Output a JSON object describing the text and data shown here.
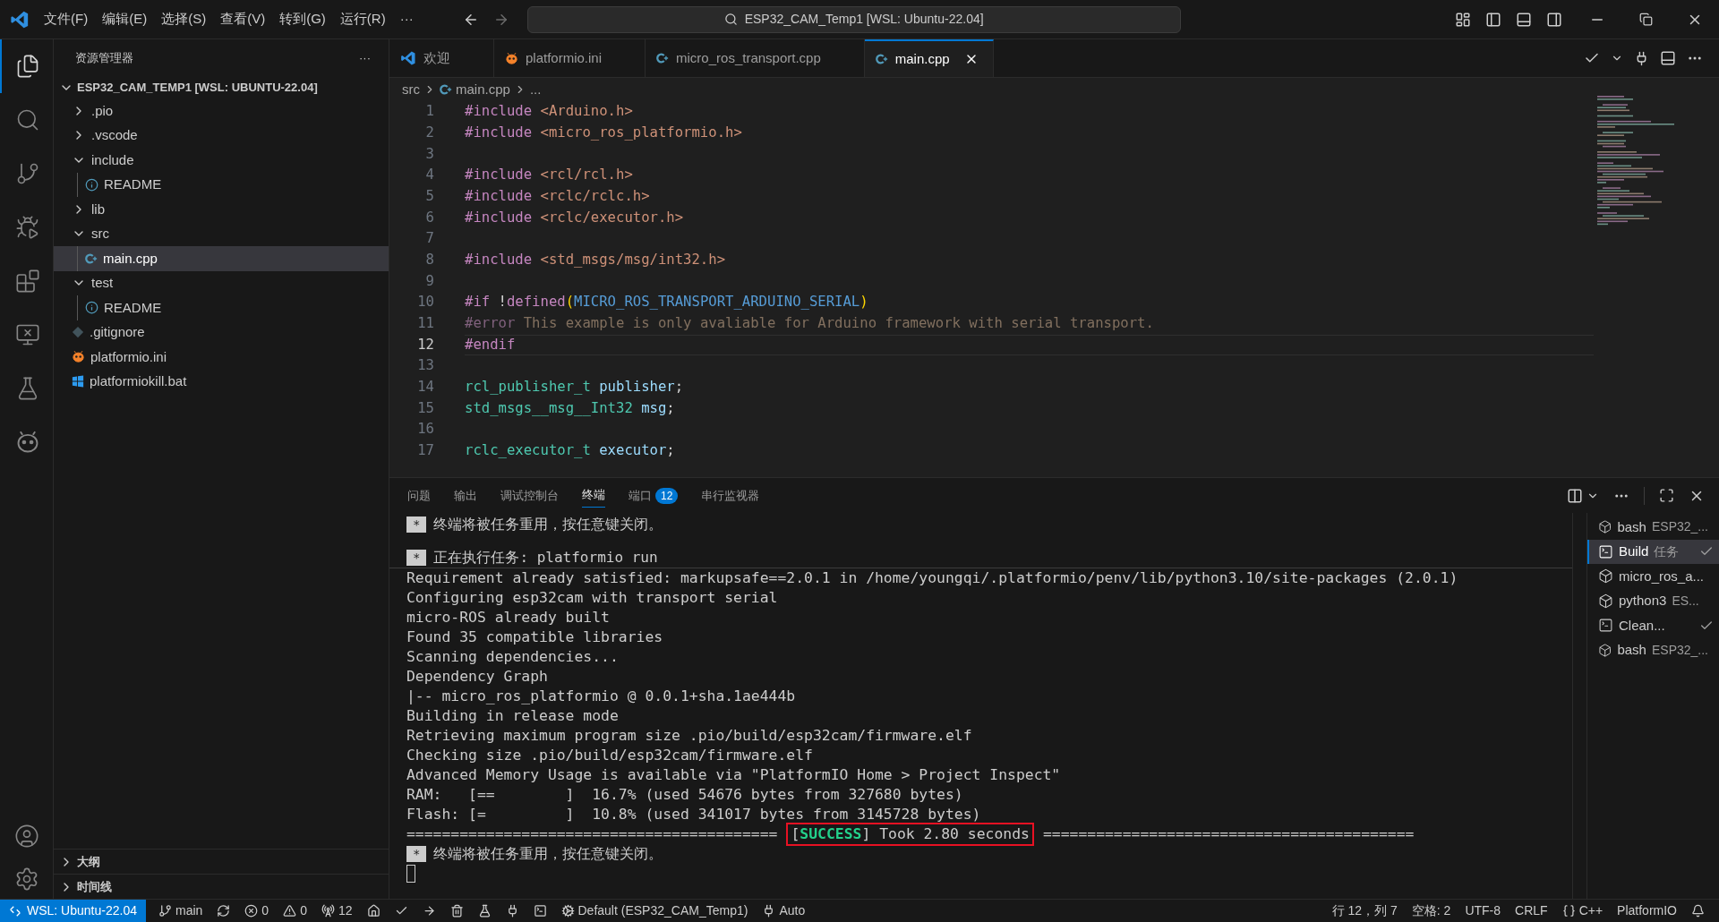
{
  "menu": [
    "文件(F)",
    "编辑(E)",
    "选择(S)",
    "查看(V)",
    "转到(G)",
    "运行(R)",
    "···"
  ],
  "command_center": {
    "text": "ESP32_CAM_Temp1 [WSL: Ubuntu-22.04]"
  },
  "activity_bar": [
    {
      "kind": "files",
      "selected": true
    },
    {
      "kind": "search",
      "selected": false
    },
    {
      "kind": "branch",
      "selected": false
    },
    {
      "kind": "debug",
      "selected": false
    },
    {
      "kind": "extensions",
      "selected": false
    },
    {
      "kind": "remote",
      "selected": false
    },
    {
      "kind": "flask",
      "selected": false
    },
    {
      "kind": "alien",
      "selected": false
    }
  ],
  "sidebar": {
    "title": "资源管理器",
    "more": "···",
    "root": "ESP32_CAM_TEMP1 [WSL: UBUNTU-22.04]",
    "items": [
      {
        "label": ".pio",
        "kind": "folder",
        "expanded": false,
        "selected": false
      },
      {
        "label": ".vscode",
        "kind": "folder",
        "expanded": false,
        "selected": false
      },
      {
        "label": "include",
        "kind": "folder",
        "expanded": true,
        "selected": false,
        "children": [
          {
            "label": "README",
            "kind": "info",
            "selected": false
          }
        ]
      },
      {
        "label": "lib",
        "kind": "folder",
        "expanded": false,
        "selected": false
      },
      {
        "label": "src",
        "kind": "folder",
        "expanded": true,
        "selected": false,
        "children": [
          {
            "label": "main.cpp",
            "kind": "cpp",
            "selected": true
          }
        ]
      },
      {
        "label": "test",
        "kind": "folder",
        "expanded": true,
        "selected": false,
        "children": [
          {
            "label": "README",
            "kind": "info",
            "selected": false
          }
        ]
      },
      {
        "label": ".gitignore",
        "kind": "git",
        "selected": false
      },
      {
        "label": "platformio.ini",
        "kind": "pio",
        "selected": false
      },
      {
        "label": "platformiokill.bat",
        "kind": "windows",
        "selected": false
      }
    ],
    "sections": [
      {
        "label": "大纲",
        "expanded": false
      },
      {
        "label": "时间线",
        "expanded": false
      }
    ]
  },
  "tabs": [
    {
      "label": "欢迎",
      "kind": "vscode",
      "selected": false
    },
    {
      "label": "platformio.ini",
      "kind": "pio",
      "selected": false
    },
    {
      "label": "micro_ros_transport.cpp",
      "kind": "cpp",
      "selected": false
    },
    {
      "label": "main.cpp",
      "kind": "cpp",
      "selected": true
    }
  ],
  "breadcrumb": [
    "src",
    "main.cpp",
    "..."
  ],
  "code": [
    {
      "n": "1",
      "current": false,
      "tokens": [
        {
          "kind": "pp",
          "text": "#include"
        },
        {
          "kind": "str",
          "text": " <Arduino.h>"
        }
      ]
    },
    {
      "n": "2",
      "current": false,
      "tokens": [
        {
          "kind": "pp",
          "text": "#include"
        },
        {
          "kind": "str",
          "text": " <micro_ros_platformio.h>"
        }
      ]
    },
    {
      "n": "3",
      "current": false
    },
    {
      "n": "4",
      "current": false,
      "tokens": [
        {
          "kind": "pp",
          "text": "#include"
        },
        {
          "kind": "str",
          "text": " <rcl/rcl.h>"
        }
      ]
    },
    {
      "n": "5",
      "current": false,
      "tokens": [
        {
          "kind": "pp",
          "text": "#include"
        },
        {
          "kind": "str",
          "text": " <rclc/rclc.h>"
        }
      ]
    },
    {
      "n": "6",
      "current": false,
      "tokens": [
        {
          "kind": "pp",
          "text": "#include"
        },
        {
          "kind": "str",
          "text": " <rclc/executor.h>"
        }
      ]
    },
    {
      "n": "7",
      "current": false
    },
    {
      "n": "8",
      "current": false,
      "tokens": [
        {
          "kind": "pp",
          "text": "#include"
        },
        {
          "kind": "str",
          "text": " <std_msgs/msg/int32.h>"
        }
      ]
    },
    {
      "n": "9",
      "current": false
    },
    {
      "n": "10",
      "current": false,
      "tokens": [
        {
          "kind": "pp",
          "text": "#if"
        },
        {
          "kind": "plain",
          "text": " !"
        },
        {
          "kind": "pp",
          "text": "defined"
        },
        {
          "kind": "paren",
          "text": "("
        },
        {
          "kind": "macro",
          "text": "MICRO_ROS_TRANSPORT_ARDUINO_SERIAL"
        },
        {
          "kind": "paren",
          "text": ")"
        }
      ]
    },
    {
      "n": "11",
      "current": false,
      "tokens": [
        {
          "kind": "pp_dim",
          "text": "#error"
        },
        {
          "kind": "dim",
          "text": " This example is only avaliable for Arduino framework with serial transport."
        }
      ]
    },
    {
      "n": "12",
      "current": true,
      "tokens": [
        {
          "kind": "pp",
          "text": "#endif"
        }
      ]
    },
    {
      "n": "13",
      "current": false
    },
    {
      "n": "14",
      "current": false,
      "tokens": [
        {
          "kind": "type",
          "text": "rcl_publisher_t"
        },
        {
          "kind": "var",
          "text": " publisher"
        },
        {
          "kind": "plain",
          "text": ";"
        }
      ]
    },
    {
      "n": "15",
      "current": false,
      "tokens": [
        {
          "kind": "type",
          "text": "std_msgs__msg__Int32"
        },
        {
          "kind": "var",
          "text": " msg"
        },
        {
          "kind": "plain",
          "text": ";"
        }
      ]
    },
    {
      "n": "16",
      "current": false
    },
    {
      "n": "17",
      "current": false,
      "tokens": [
        {
          "kind": "type",
          "text": "rclc_executor_t"
        },
        {
          "kind": "var",
          "text": " executor"
        },
        {
          "kind": "plain",
          "text": ";"
        }
      ]
    }
  ],
  "panel": {
    "tabs": [
      {
        "label": "问题",
        "selected": false
      },
      {
        "label": "输出",
        "selected": false
      },
      {
        "label": "调试控制台",
        "selected": false
      },
      {
        "label": "终端",
        "selected": true
      },
      {
        "label": "端口",
        "badge": "12",
        "selected": false
      },
      {
        "label": "串行监视器",
        "selected": false
      }
    ],
    "terminal": [
      {
        "kind": "task",
        "badge": "*",
        "text": "终端将被任务重用，按任意键关闭。"
      },
      {
        "kind": "task",
        "badge": "*",
        "text": "正在执行任务: platformio run"
      },
      {
        "kind": "text",
        "text": "Requirement already satisfied: markupsafe==2.0.1 in /home/youngqi/.platformio/penv/lib/python3.10/site-packages (2.0.1)"
      },
      {
        "kind": "text",
        "text": "Configuring esp32cam with transport serial"
      },
      {
        "kind": "text",
        "text": "micro-ROS already built"
      },
      {
        "kind": "text",
        "text": "Found 35 compatible libraries"
      },
      {
        "kind": "text",
        "text": "Scanning dependencies..."
      },
      {
        "kind": "text",
        "text": "Dependency Graph"
      },
      {
        "kind": "text",
        "text": "|-- micro_ros_platformio @ 0.0.1+sha.1ae444b"
      },
      {
        "kind": "text",
        "text": "Building in release mode"
      },
      {
        "kind": "text",
        "text": "Retrieving maximum program size .pio/build/esp32cam/firmware.elf"
      },
      {
        "kind": "text",
        "text": "Checking size .pio/build/esp32cam/firmware.elf"
      },
      {
        "kind": "text",
        "text": "Advanced Memory Usage is available via \"PlatformIO Home > Project Inspect\""
      },
      {
        "kind": "text",
        "text": "RAM:   [==        ]  16.7% (used 54676 bytes from 327680 bytes)"
      },
      {
        "kind": "text",
        "text": "Flash: [=         ]  10.8% (used 341017 bytes from 3145728 bytes)"
      },
      {
        "kind": "banner",
        "rule_left": "==========================================",
        "open": "[",
        "label": "SUCCESS",
        "rest": "] Took 2.80 seconds",
        "rule_right": "=========================================="
      },
      {
        "kind": "task",
        "badge": "*",
        "text": "终端将被任务重用，按任意键关闭。"
      },
      {
        "kind": "cursor"
      }
    ],
    "sessions": [
      {
        "kind": "shell",
        "name": "bash",
        "detail": "ESP32_...",
        "done": false,
        "selected": false
      },
      {
        "kind": "task",
        "name": "Build",
        "detail": "任务",
        "done": true,
        "selected": true
      },
      {
        "kind": "shell",
        "name": "micro_ros_a...",
        "done": false,
        "selected": false
      },
      {
        "kind": "shell",
        "name": "python3",
        "detail": "ES...",
        "done": false,
        "selected": false
      },
      {
        "kind": "task",
        "name": "Clean...",
        "done": true,
        "selected": false
      },
      {
        "kind": "shell",
        "name": "bash",
        "detail": "ESP32_...",
        "done": false,
        "selected": false
      }
    ]
  },
  "status_bar": {
    "remote": "WSL: Ubuntu-22.04",
    "left": [
      {
        "kind": "branch",
        "text": "main"
      },
      {
        "kind": "sync"
      },
      {
        "kind": "error",
        "text": "0"
      },
      {
        "kind": "warning",
        "text": "0"
      },
      {
        "kind": "ports",
        "text": "12"
      },
      {
        "kind": "home"
      },
      {
        "kind": "check"
      },
      {
        "kind": "arrow"
      },
      {
        "kind": "trash"
      },
      {
        "kind": "flask"
      },
      {
        "kind": "plug"
      },
      {
        "kind": "terminal"
      },
      {
        "kind": "env",
        "text": "Default (ESP32_CAM_Temp1)"
      },
      {
        "kind": "plug",
        "text": "Auto"
      }
    ],
    "right": [
      {
        "text": "行 12，列 7"
      },
      {
        "text": "空格: 2"
      },
      {
        "text": "UTF-8"
      },
      {
        "text": "CRLF"
      },
      {
        "kind": "braces",
        "text": "C++"
      },
      {
        "text": "PlatformIO"
      },
      {
        "kind": "bell"
      }
    ]
  }
}
